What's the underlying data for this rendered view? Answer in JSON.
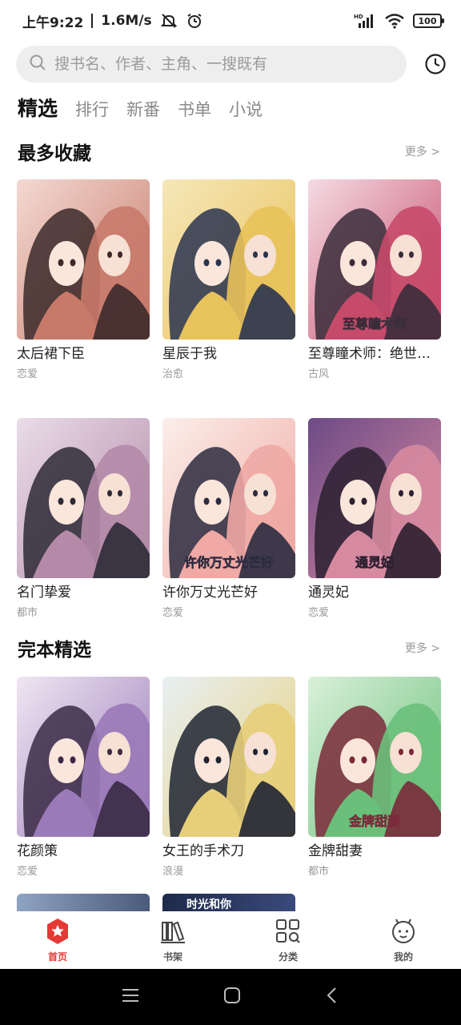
{
  "status_bar": {
    "time": "上午9:22",
    "speed": "1.6M/s",
    "hd_label": "HD",
    "battery": "100"
  },
  "search": {
    "placeholder": "搜书名、作者、主角、一搜既有"
  },
  "tabs": [
    {
      "label": "精选",
      "active": true
    },
    {
      "label": "排行",
      "active": false
    },
    {
      "label": "新番",
      "active": false
    },
    {
      "label": "书单",
      "active": false
    },
    {
      "label": "小说",
      "active": false
    }
  ],
  "sections": [
    {
      "title": "最多收藏",
      "more": "更多 >",
      "books": [
        {
          "title": "太后裙下臣",
          "genre": "恋爱",
          "palette": [
            "#f3d9d2",
            "#c87a6a",
            "#3b2a2a"
          ]
        },
        {
          "title": "星辰于我",
          "genre": "治愈",
          "palette": [
            "#f6e7b9",
            "#e8c25a",
            "#2a3450"
          ]
        },
        {
          "title": "至尊瞳术师：绝世…",
          "genre": "古风",
          "palette": [
            "#f4dbe3",
            "#c64a6a",
            "#3a2d3a"
          ],
          "cover_text": "至尊瞳术师"
        },
        {
          "title": "名门挚爱",
          "genre": "都市",
          "palette": [
            "#e9dce8",
            "#b48aa8",
            "#2e2a36"
          ]
        },
        {
          "title": "许你万丈光芒好",
          "genre": "恋爱",
          "palette": [
            "#fbeee9",
            "#f0a9a4",
            "#2b2b40"
          ],
          "cover_text": "许你万丈光芒好"
        },
        {
          "title": "通灵妃",
          "genre": "恋爱",
          "palette": [
            "#6e4b86",
            "#d68aa0",
            "#2b2030"
          ],
          "cover_text": "通灵妃"
        }
      ]
    },
    {
      "title": "完本精选",
      "more": "更多 >",
      "books": [
        {
          "title": "花颜策",
          "genre": "恋爱",
          "palette": [
            "#efe6f2",
            "#9a7ab8",
            "#3a2a45"
          ]
        },
        {
          "title": "女王的手术刀",
          "genre": "浪漫",
          "palette": [
            "#e8f0f4",
            "#e7cf7a",
            "#1f2433"
          ]
        },
        {
          "title": "金牌甜妻",
          "genre": "都市",
          "palette": [
            "#d9f0d9",
            "#6ac07a",
            "#7a2a3a"
          ],
          "cover_text": "金牌甜妻"
        }
      ]
    }
  ],
  "partial_covers": [
    {
      "palette": [
        "#8fa3c4",
        "#4a5a7a"
      ]
    },
    {
      "palette": [
        "#1e2a4a",
        "#3a4a7a"
      ],
      "cover_text": "时光和你"
    }
  ],
  "bottom_nav": [
    {
      "label": "首页",
      "icon": "home-star-icon",
      "active": true
    },
    {
      "label": "书架",
      "icon": "bookshelf-icon",
      "active": false
    },
    {
      "label": "分类",
      "icon": "category-grid-icon",
      "active": false
    },
    {
      "label": "我的",
      "icon": "profile-face-icon",
      "active": false
    }
  ],
  "colors": {
    "accent": "#e53935",
    "search_bg": "#eeeeee",
    "muted_text": "#999999"
  }
}
